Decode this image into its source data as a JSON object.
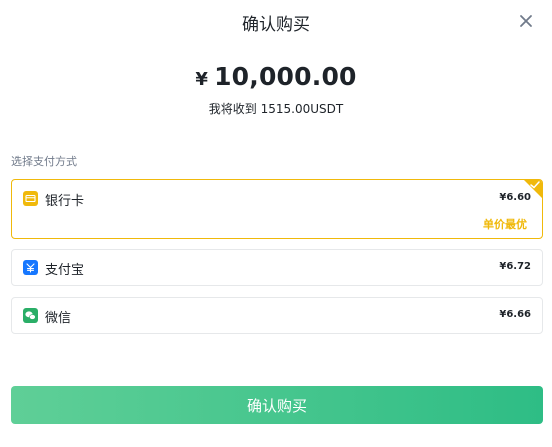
{
  "dialog": {
    "title": "确认购买",
    "close_icon": "close-icon"
  },
  "summary": {
    "currency_symbol": "¥",
    "amount": "10,000.00",
    "receive_text": "我将收到 1515.00USDT"
  },
  "payment": {
    "section_label": "选择支付方式",
    "methods": [
      {
        "icon": "bank-card-icon",
        "name": "银行卡",
        "price": "¥6.60",
        "tag": "单价最优",
        "selected": true
      },
      {
        "icon": "alipay-icon",
        "name": "支付宝",
        "price": "¥6.72",
        "selected": false
      },
      {
        "icon": "wechat-icon",
        "name": "微信",
        "price": "¥6.66",
        "selected": false
      }
    ]
  },
  "footer": {
    "confirm_label": "确认购买"
  },
  "colors": {
    "accent": "#f0b90b",
    "button_start": "#5fcf97",
    "button_end": "#2ebd85",
    "alipay": "#1677ff",
    "wechat": "#2aae67",
    "text": "#1e2329",
    "muted": "#707a8a"
  }
}
